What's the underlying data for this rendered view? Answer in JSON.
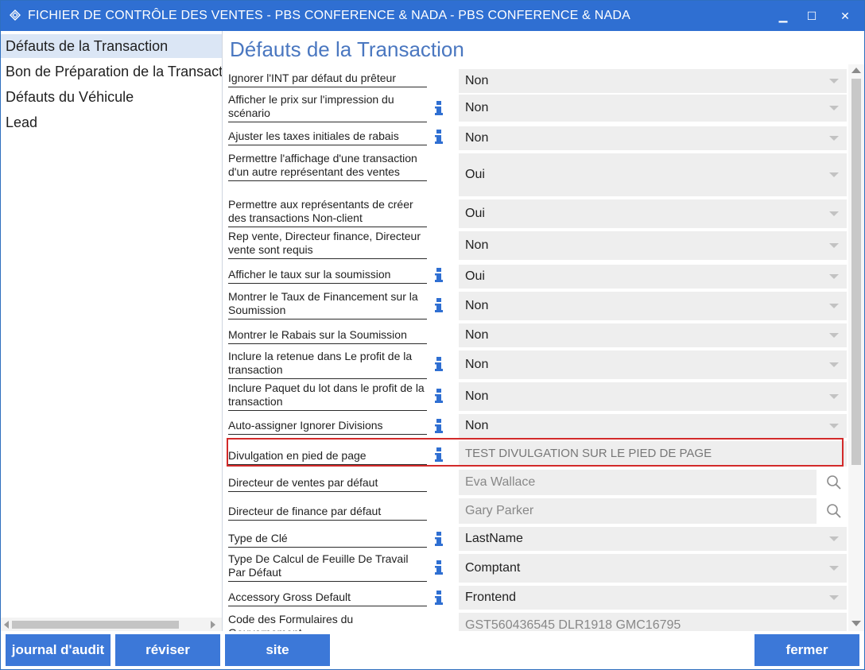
{
  "window": {
    "title": "FICHIER DE CONTRÔLE DES VENTES - PBS CONFERENCE & NADA - PBS CONFERENCE & NADA",
    "controls": {
      "minimize": "▁",
      "maximize": "☐",
      "close": "✕"
    }
  },
  "sidebar": {
    "items": [
      {
        "label": "Défauts de la Transaction",
        "active": true
      },
      {
        "label": "Bon de Préparation de la Transaction",
        "active": false
      },
      {
        "label": "Défauts du Véhicule",
        "active": false
      },
      {
        "label": "Lead",
        "active": false
      }
    ]
  },
  "main": {
    "title": "Défauts de la Transaction",
    "rows": [
      {
        "label": "Ignorer l'INT par défaut du prêteur",
        "info": false,
        "value": "Non",
        "kind": "select"
      },
      {
        "label": "Afficher le prix sur l'impression du scénario",
        "info": true,
        "value": "Non",
        "kind": "select"
      },
      {
        "label": "Ajuster les taxes initiales de rabais",
        "info": true,
        "value": "Non",
        "kind": "select"
      },
      {
        "label": "Permettre l'affichage d'une transaction d'un autre représentant des ventes",
        "info": false,
        "value": "Oui",
        "kind": "select"
      },
      {
        "label": "Permettre aux représentants de créer des transactions Non-client",
        "info": false,
        "value": "Oui",
        "kind": "select"
      },
      {
        "label": "Rep vente, Directeur finance, Directeur vente sont requis",
        "info": false,
        "value": "Non",
        "kind": "select"
      },
      {
        "label": "Afficher le taux sur la soumission",
        "info": true,
        "value": "Oui",
        "kind": "select"
      },
      {
        "label": "Montrer le Taux de Financement sur la Soumission",
        "info": true,
        "value": "Non",
        "kind": "select"
      },
      {
        "label": "Montrer le Rabais sur la Soumission",
        "info": false,
        "value": "Non",
        "kind": "select"
      },
      {
        "label": "Inclure la retenue dans Le profit de la transaction",
        "info": true,
        "value": "Non",
        "kind": "select"
      },
      {
        "label": "Inclure Paquet du lot dans le profit de la transaction",
        "info": true,
        "value": "Non",
        "kind": "select"
      },
      {
        "label": "Auto-assigner Ignorer Divisions",
        "info": true,
        "value": "Non",
        "kind": "select"
      },
      {
        "label": "Divulgation en pied de page",
        "info": true,
        "value": "TEST DIVULGATION SUR LE PIED DE PAGE",
        "kind": "text",
        "highlighted": true
      },
      {
        "label": "Directeur de ventes par défaut",
        "info": false,
        "value": "Eva Wallace",
        "kind": "lookup"
      },
      {
        "label": "Directeur de finance par défaut",
        "info": false,
        "value": "Gary Parker",
        "kind": "lookup"
      },
      {
        "label": "Type de Clé",
        "info": true,
        "value": "LastName",
        "kind": "select"
      },
      {
        "label": "Type De Calcul de Feuille De Travail Par Défaut",
        "info": true,
        "value": "Comptant",
        "kind": "select"
      },
      {
        "label": "Accessory Gross Default",
        "info": true,
        "value": "Frontend",
        "kind": "select"
      },
      {
        "label": "Code des Formulaires du Gouvernement",
        "info": false,
        "value": "GST560436545 DLR1918 GMC16795",
        "kind": "readonly"
      }
    ]
  },
  "footer": {
    "audit_label": "journal d'audit",
    "review_label": "réviser",
    "site_label": "site",
    "close_label": "fermer"
  },
  "colors": {
    "titlebar": "#2f6fd2",
    "button": "#3c78d8",
    "title_text": "#4a77c0",
    "highlight_border": "#d22a2a",
    "info_icon": "#2f6fd2"
  }
}
